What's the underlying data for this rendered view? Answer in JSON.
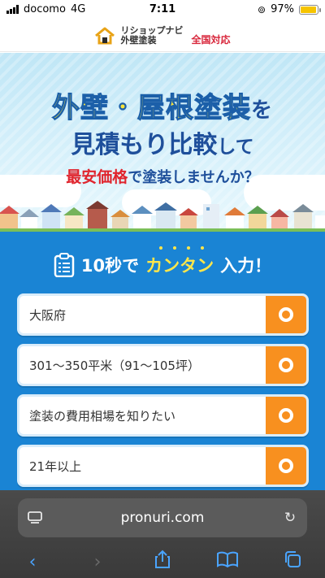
{
  "status": {
    "carrier": "docomo",
    "network": "4G",
    "time": "7:11",
    "battery": "97%",
    "battery_level": 0.97
  },
  "header": {
    "logo_line1": "リショップナビ",
    "logo_line2": "外壁塗装",
    "nationwide": "全国対応"
  },
  "hero": {
    "line1_a": "外壁・屋根塗装",
    "line1_b": "を",
    "line2_a": "見積もり比較",
    "line2_b": "して",
    "line3_a": "最安価格",
    "line3_b": "で塗装しませんか？"
  },
  "form": {
    "title_a": "10秒で",
    "title_b": "カンタン",
    "title_c": "入力！",
    "fields": [
      {
        "value": "大阪府"
      },
      {
        "value": "301〜350平米（91〜105坪）"
      },
      {
        "value": "塗装の費用相場を知りたい"
      },
      {
        "value": "21年以上"
      }
    ]
  },
  "browser": {
    "url": "pronuri.com"
  },
  "icons": {
    "signal": "signal-icon",
    "lock_rotation": "orientation-lock-icon",
    "battery": "battery-icon",
    "reader": "reader-icon",
    "reload": "reload-icon",
    "back": "back-icon",
    "forward": "forward-icon",
    "share": "share-icon",
    "bookmarks": "bookmarks-icon",
    "tabs": "tabs-icon"
  },
  "colors": {
    "accent_blue": "#1a84d4",
    "orange": "#f8901f",
    "yellow": "#ffe64a",
    "red": "#e0242d"
  }
}
